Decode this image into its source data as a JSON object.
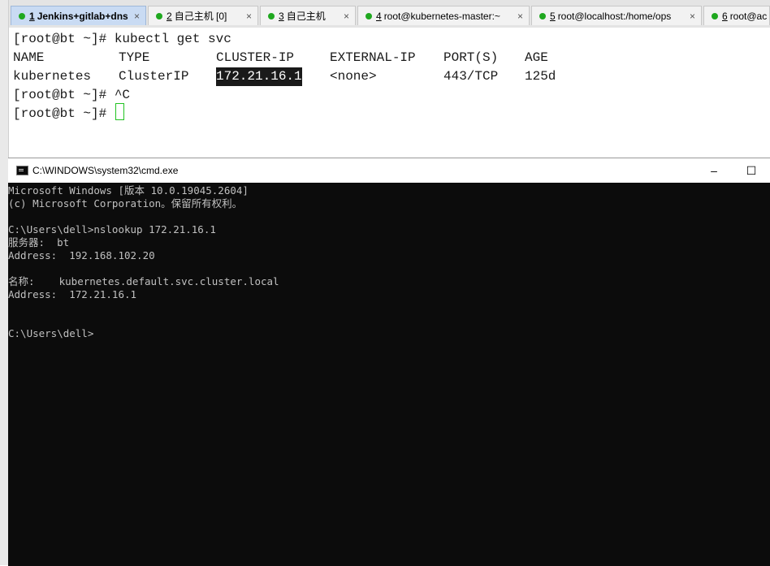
{
  "tabs": [
    {
      "num": "1",
      "label": "Jenkins+gitlab+dns",
      "active": true
    },
    {
      "num": "2",
      "label": "自己主机 [0]"
    },
    {
      "num": "3",
      "label": "自己主机"
    },
    {
      "num": "4",
      "label": "root@kubernetes-master:~"
    },
    {
      "num": "5",
      "label": "root@localhost:/home/ops"
    },
    {
      "num": "6",
      "label": "root@ac"
    }
  ],
  "tab_close_glyph": "×",
  "upper_terminal": {
    "prompt": "[root@bt ~]#",
    "line1_command": "kubectl get svc",
    "headers": [
      "NAME",
      "TYPE",
      "CLUSTER-IP",
      "EXTERNAL-IP",
      "PORT(S)",
      "AGE"
    ],
    "row": [
      "kubernetes",
      "ClusterIP",
      "172.21.16.1",
      "<none>",
      "443/TCP",
      "125d"
    ],
    "line4_command": "^C",
    "line5_command": ""
  },
  "cmd_window": {
    "title": "C:\\WINDOWS\\system32\\cmd.exe",
    "minimize_glyph": "–",
    "maximize_glyph": "☐",
    "lines": [
      "Microsoft Windows [版本 10.0.19045.2604]",
      "(c) Microsoft Corporation。保留所有权利。",
      "",
      "C:\\Users\\dell>nslookup 172.21.16.1",
      "服务器:  bt",
      "Address:  192.168.102.20",
      "",
      "名称:    kubernetes.default.svc.cluster.local",
      "Address:  172.21.16.1",
      "",
      "",
      "C:\\Users\\dell>"
    ]
  },
  "colors": {
    "tab_active_bg": "#c9dbf3",
    "status_dot": "#1fa81f",
    "cursor_border": "#22c322",
    "cmd_bg": "#0c0c0c",
    "cmd_text": "#c0c0c0"
  }
}
